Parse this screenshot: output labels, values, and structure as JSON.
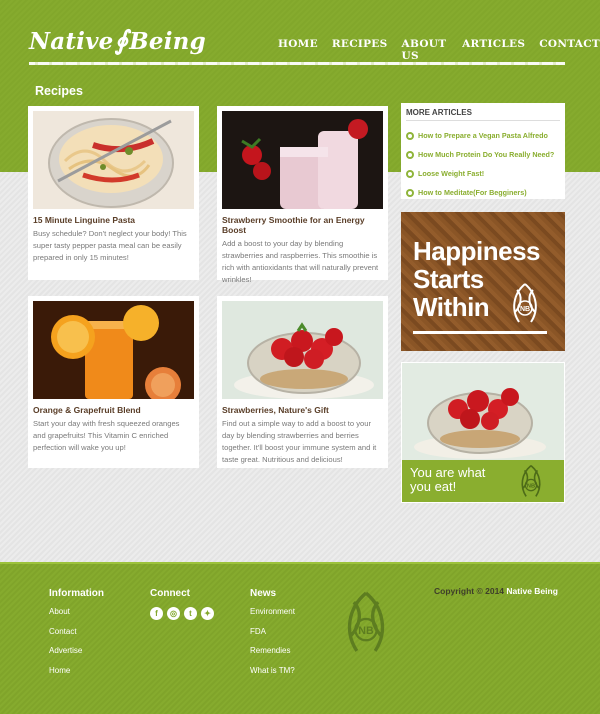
{
  "site": {
    "logo_word1": "Native",
    "logo_word2": "Being"
  },
  "nav": {
    "items": [
      "HOME",
      "RECIPES",
      "ABOUT US",
      "ARTICLES",
      "CONTACT"
    ]
  },
  "main": {
    "section_title": "Recipes",
    "cards": [
      {
        "title": "15 Minute Linguine Pasta",
        "text": "Busy schedule? Don't neglect your body! This super tasty pepper pasta meal can be easily prepared in only 15 minutes!"
      },
      {
        "title": "Strawberry Smoothie for an Energy Boost",
        "text": "Add a boost to your day by blending strawberries and raspberries. This smoothie is rich with antioxidants that will naturally prevent wrinkles!"
      },
      {
        "title": "Orange & Grapefruit Blend",
        "text": "Start your day with fresh squeezed oranges and grapefruits! This Vitamin C enriched perfection will wake you up!"
      },
      {
        "title": "Strawberries, Nature's Gift",
        "text": "Find out a simple way to add a boost to your day by blending strawberries and berries together. It'll boost your immune system and it taste great. Nutritious and delicious!"
      }
    ]
  },
  "sidebar": {
    "more_title": "MORE ARTICLES",
    "articles": [
      "How to Prepare a Vegan Pasta Alfredo",
      "How Much Protein Do You Really Need?",
      "Loose Weight Fast!",
      "How to Meditate(For Begginers)"
    ],
    "ad1": {
      "line1": "Happiness",
      "line2": "Starts",
      "line3": "Within",
      "monogram": "NB"
    },
    "ad2": {
      "line1": "You are what",
      "line2": "you eat!",
      "monogram": "NB"
    }
  },
  "footer": {
    "information": {
      "title": "Information",
      "links": [
        "About",
        "Contact",
        "Advertise",
        "Home"
      ]
    },
    "connect": {
      "title": "Connect",
      "icons": [
        "facebook-icon",
        "instagram-icon",
        "tumblr-icon",
        "twitter-icon"
      ],
      "glyphs": [
        "f",
        "◎",
        "t",
        "✦"
      ]
    },
    "news": {
      "title": "News",
      "links": [
        "Environment",
        "FDA",
        "Remendies",
        "What is TM?"
      ]
    },
    "monogram": "NB",
    "copyright_prefix": "Copyright © 2014",
    "copyright_brand": "Native Being"
  },
  "colors": {
    "brand_green": "#86ab2e",
    "link_green": "#8aae2f",
    "wood": "#8a5526"
  }
}
